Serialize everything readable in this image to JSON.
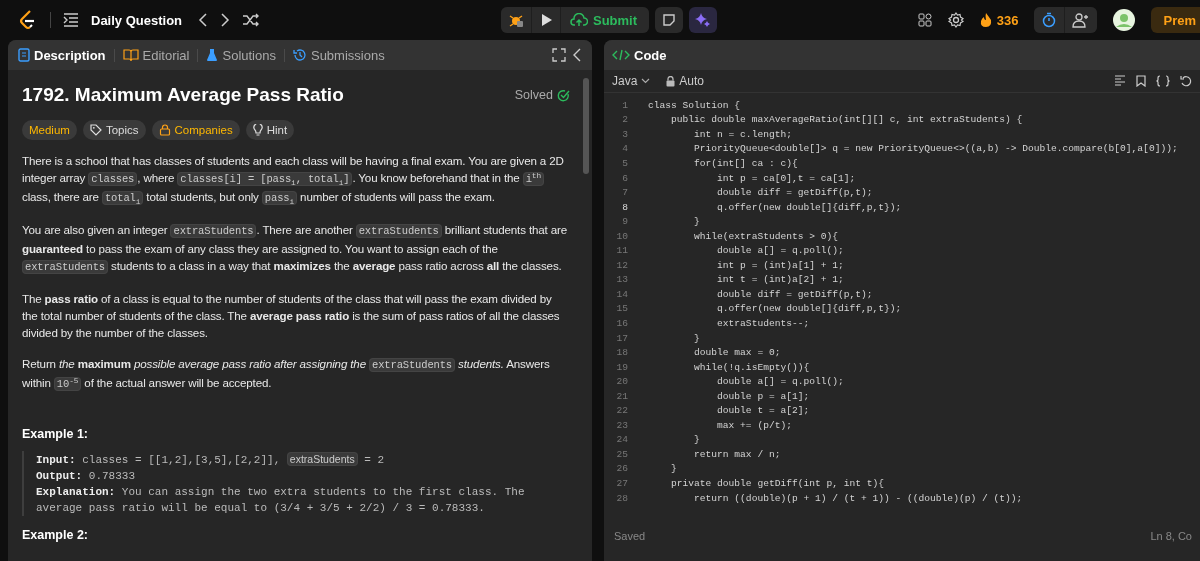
{
  "top_bar": {
    "title": "Daily Question",
    "submit": "Submit",
    "streak": "336",
    "premium": "Prem"
  },
  "left_tabs": [
    {
      "label": "Description",
      "kind": "description",
      "selected": true
    },
    {
      "label": "Editorial",
      "kind": "editorial",
      "selected": false
    },
    {
      "label": "Solutions",
      "kind": "solutions",
      "selected": false
    },
    {
      "label": "Submissions",
      "kind": "submissions",
      "selected": false
    }
  ],
  "problem": {
    "title": "1792. Maximum Average Pass Ratio",
    "status": "Solved",
    "tags": [
      {
        "label": "Medium",
        "kind": "difficulty"
      },
      {
        "label": "Topics",
        "kind": "topics"
      },
      {
        "label": "Companies",
        "kind": "companies"
      },
      {
        "label": "Hint",
        "kind": "hint"
      }
    ],
    "paragraphs": [
      [
        {
          "kind": "text",
          "text": "There is a school that has classes of students and each class will be having a final exam. You are given a 2D integer array "
        },
        {
          "kind": "code",
          "text": "classes"
        },
        {
          "kind": "text",
          "text": ", where "
        },
        {
          "kind": "code",
          "text": "classes[i] = [pass$_{i}$, total$_{i}$]"
        },
        {
          "kind": "text",
          "text": ". You know beforehand that in the "
        },
        {
          "kind": "code",
          "text": "i$^{th}$"
        },
        {
          "kind": "text",
          "text": " class, there are "
        },
        {
          "kind": "code",
          "text": "total$_{i}$"
        },
        {
          "kind": "text",
          "text": " total students, but only "
        },
        {
          "kind": "code",
          "text": "pass$_{i}$"
        },
        {
          "kind": "text",
          "text": " number of students will pass the exam."
        }
      ],
      [
        {
          "kind": "text",
          "text": "You are also given an integer "
        },
        {
          "kind": "code",
          "text": "extraStudents"
        },
        {
          "kind": "text",
          "text": ". There are another "
        },
        {
          "kind": "code",
          "text": "extraStudents"
        },
        {
          "kind": "text",
          "text": " brilliant students that are **guaranteed** to pass the exam of any class they are assigned to. You want to assign each of the "
        },
        {
          "kind": "code",
          "text": "extraStudents"
        },
        {
          "kind": "text",
          "text": " students to a class in a way that **maximizes** the **average** pass ratio across **all** the classes."
        }
      ],
      [
        {
          "kind": "text",
          "text": "The **pass ratio** of a class is equal to the number of students of the class that will pass the exam divided by the total number of students of the class. The **average pass ratio** is the sum of pass ratios of all the classes divided by the number of the classes."
        }
      ],
      [
        {
          "kind": "text",
          "text": "Return *the* **maximum** *possible average pass ratio after assigning the* "
        },
        {
          "kind": "code",
          "text": "extraStudents"
        },
        {
          "kind": "text",
          "text": " *students.* Answers within "
        },
        {
          "kind": "code",
          "text": "10$^{-5}$"
        },
        {
          "kind": "text",
          "text": " of the actual answer will be accepted."
        }
      ]
    ],
    "examples": [
      {
        "heading": "Example 1:",
        "lines": [
          [
            {
              "kind": "text",
              "text": "**Input:** classes = [[1,2],[3,5],[2,2]], "
            },
            {
              "kind": "code",
              "text": "extraStudents"
            },
            {
              "kind": "text",
              "text": " = 2"
            }
          ],
          [
            {
              "kind": "text",
              "text": "**Output:** 0.78333"
            }
          ],
          [
            {
              "kind": "text",
              "text": "**Explanation:** You can assign the two extra students to the first class. The average pass ratio will be equal to (3/4 + 3/5 + 2/2) / 3 = 0.78333."
            }
          ]
        ]
      },
      {
        "heading": "Example 2:"
      }
    ]
  },
  "editor": {
    "title": "Code",
    "language": "Java",
    "mode": "Auto",
    "status": "Saved",
    "cursor": "Ln 8, Co",
    "lines": [
      {
        "number": "1",
        "code": "class Solution {",
        "current": false
      },
      {
        "number": "2",
        "code": "    public double maxAverageRatio(int[][] c, int extraStudents) {",
        "current": false
      },
      {
        "number": "3",
        "code": "        int n = c.length;",
        "current": false
      },
      {
        "number": "4",
        "code": "        PriorityQueue<double[]> q = new PriorityQueue<>((a,b) -> Double.compare(b[0],a[0]));",
        "current": false
      },
      {
        "number": "5",
        "code": "        for(int[] ca : c){",
        "current": false
      },
      {
        "number": "6",
        "code": "            int p = ca[0],t = ca[1];",
        "current": false
      },
      {
        "number": "7",
        "code": "            double diff = getDiff(p,t);",
        "current": false
      },
      {
        "number": "8",
        "code": "            q.offer(new double[]{diff,p,t});",
        "current": true
      },
      {
        "number": "9",
        "code": "        }",
        "current": false
      },
      {
        "number": "10",
        "code": "        while(extraStudents > 0){",
        "current": false
      },
      {
        "number": "11",
        "code": "            double a[] = q.poll();",
        "current": false
      },
      {
        "number": "12",
        "code": "            int p = (int)a[1] + 1;",
        "current": false
      },
      {
        "number": "13",
        "code": "            int t = (int)a[2] + 1;",
        "current": false
      },
      {
        "number": "14",
        "code": "            double diff = getDiff(p,t);",
        "current": false
      },
      {
        "number": "15",
        "code": "            q.offer(new double[]{diff,p,t});",
        "current": false
      },
      {
        "number": "16",
        "code": "            extraStudents--;",
        "current": false
      },
      {
        "number": "17",
        "code": "        }",
        "current": false
      },
      {
        "number": "18",
        "code": "        double max = 0;",
        "current": false
      },
      {
        "number": "19",
        "code": "        while(!q.isEmpty()){",
        "current": false
      },
      {
        "number": "20",
        "code": "            double a[] = q.poll();",
        "current": false
      },
      {
        "number": "21",
        "code": "            double p = a[1];",
        "current": false
      },
      {
        "number": "22",
        "code": "            double t = a[2];",
        "current": false
      },
      {
        "number": "23",
        "code": "            max += (p/t);",
        "current": false
      },
      {
        "number": "24",
        "code": "        }",
        "current": false
      },
      {
        "number": "25",
        "code": "        return max / n;",
        "current": false
      },
      {
        "number": "26",
        "code": "    }",
        "current": false
      },
      {
        "number": "27",
        "code": "    private double getDiff(int p, int t){",
        "current": false
      },
      {
        "number": "28",
        "code": "        return ((double)(p + 1) / (t + 1)) - ((double)(p) / (t));",
        "current": false
      }
    ]
  }
}
